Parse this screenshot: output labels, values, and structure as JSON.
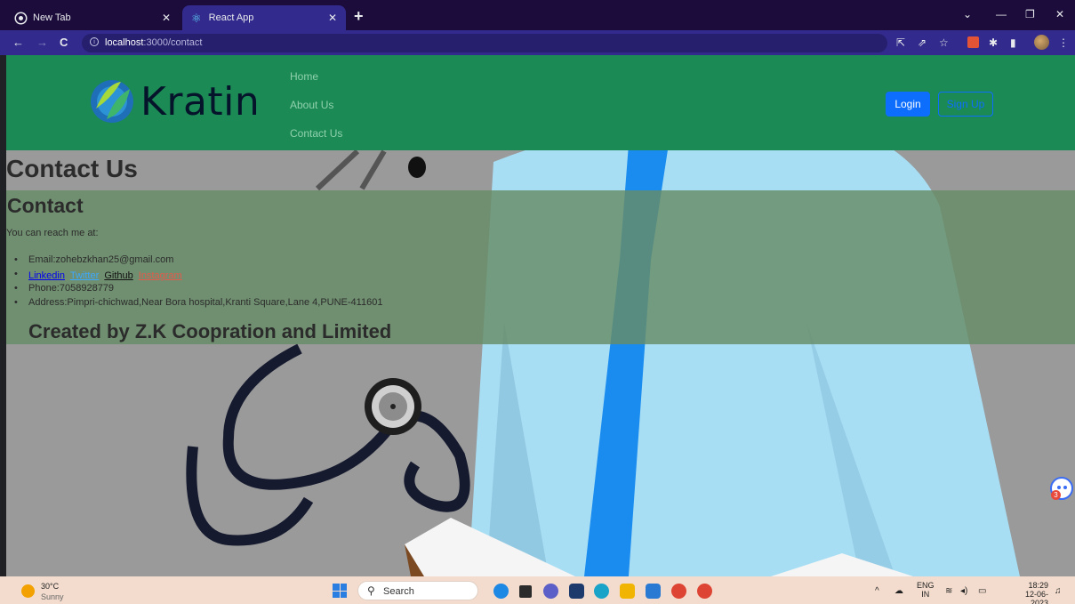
{
  "browser": {
    "tabs": [
      {
        "title": "New Tab",
        "active": false
      },
      {
        "title": "React App",
        "active": true
      }
    ],
    "url_host": "localhost",
    "url_path": ":3000/contact"
  },
  "navbar": {
    "brand": "Kratin",
    "links": [
      "Home",
      "About Us",
      "Contact Us"
    ],
    "login_label": "Login",
    "signup_label": "Sign Up"
  },
  "page": {
    "heading": "Contact Us",
    "section_title": "Contact",
    "reach_text": "You can reach me at:",
    "email": "Email:zohebzkhan25@gmail.com",
    "social": {
      "linkedin": "Linkedin",
      "twitter": "Twitter",
      "github": "Github",
      "instagram": "Instagram"
    },
    "phone": "Phone:7058928779",
    "address": "Address:Pimpri-chichwad,Near Bora hospital,Kranti Square,Lane 4,PUNE-411601",
    "creator": "Created by Z.K Coopration and Limited",
    "chat_badge": "3"
  },
  "taskbar": {
    "weather_temp": "30°C",
    "weather_cond": "Sunny",
    "search_placeholder": "Search",
    "lang_top": "ENG",
    "lang_bottom": "IN",
    "time": "18:29",
    "date": "12-06-2023"
  },
  "colors": {
    "navbar": "#1c8a55",
    "panel": "#678c67",
    "login": "#0d6efd",
    "tab_active": "#322a8c"
  }
}
